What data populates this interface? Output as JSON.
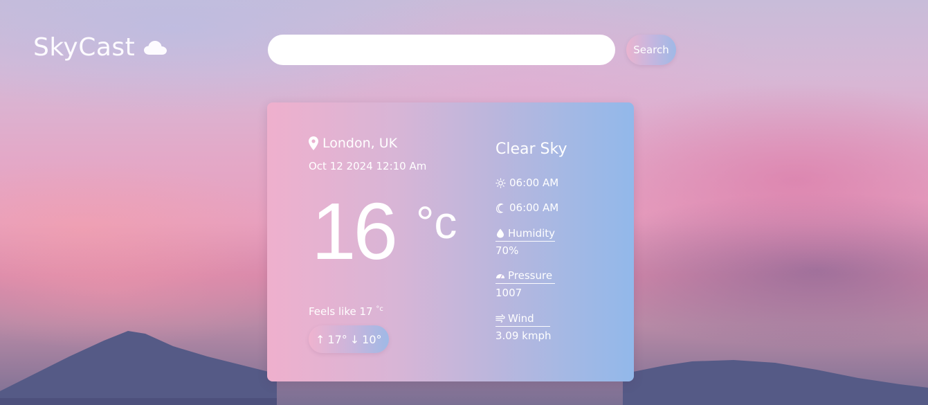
{
  "app": {
    "name": "SkyCast"
  },
  "search": {
    "value": "",
    "placeholder": "",
    "button_label": "Search"
  },
  "weather": {
    "location": "London, UK",
    "datetime": "Oct 12 2024 12:10 Am",
    "temperature": "16",
    "unit": "°c",
    "feels_like_label": "Feels like 17",
    "feels_like_unit": "°c",
    "high": "17°",
    "low": "10°",
    "condition": "Clear Sky",
    "sunrise": "06:00 AM",
    "sunset": "06:00 AM",
    "humidity_label": "Humidity",
    "humidity_value": "70%",
    "pressure_label": "Pressure",
    "pressure_value": "1007",
    "wind_label": "Wind",
    "wind_value": "3.09 kmph"
  },
  "icons": {
    "logo": "cloud-icon",
    "location": "map-pin-icon",
    "sunrise": "sun-icon",
    "sunset": "moon-icon",
    "humidity": "droplet-icon",
    "pressure": "gauge-icon",
    "wind": "wind-icon"
  },
  "colors": {
    "card_start": "#efb0cd",
    "card_end": "#92b8ea",
    "text": "#ffffff"
  }
}
